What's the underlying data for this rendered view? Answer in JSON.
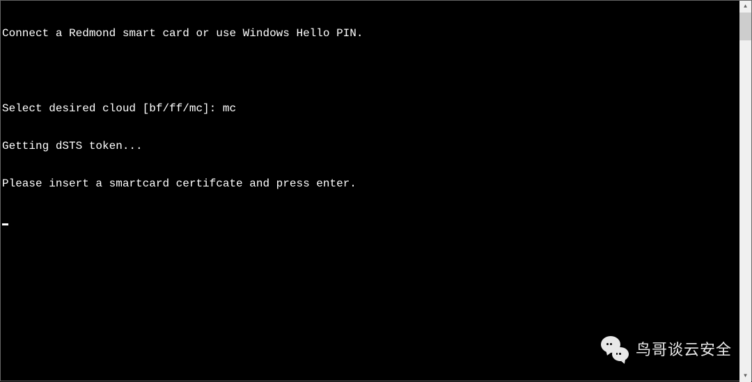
{
  "terminal": {
    "lines": [
      "Connect a Redmond smart card or use Windows Hello PIN.",
      "",
      "Select desired cloud [bf/ff/mc]: mc",
      "Getting dSTS token...",
      "Please insert a smartcard certifcate and press enter."
    ]
  },
  "scrollbar": {
    "up_glyph": "▲",
    "down_glyph": "▼"
  },
  "watermark": {
    "text": "鸟哥谈云安全"
  }
}
